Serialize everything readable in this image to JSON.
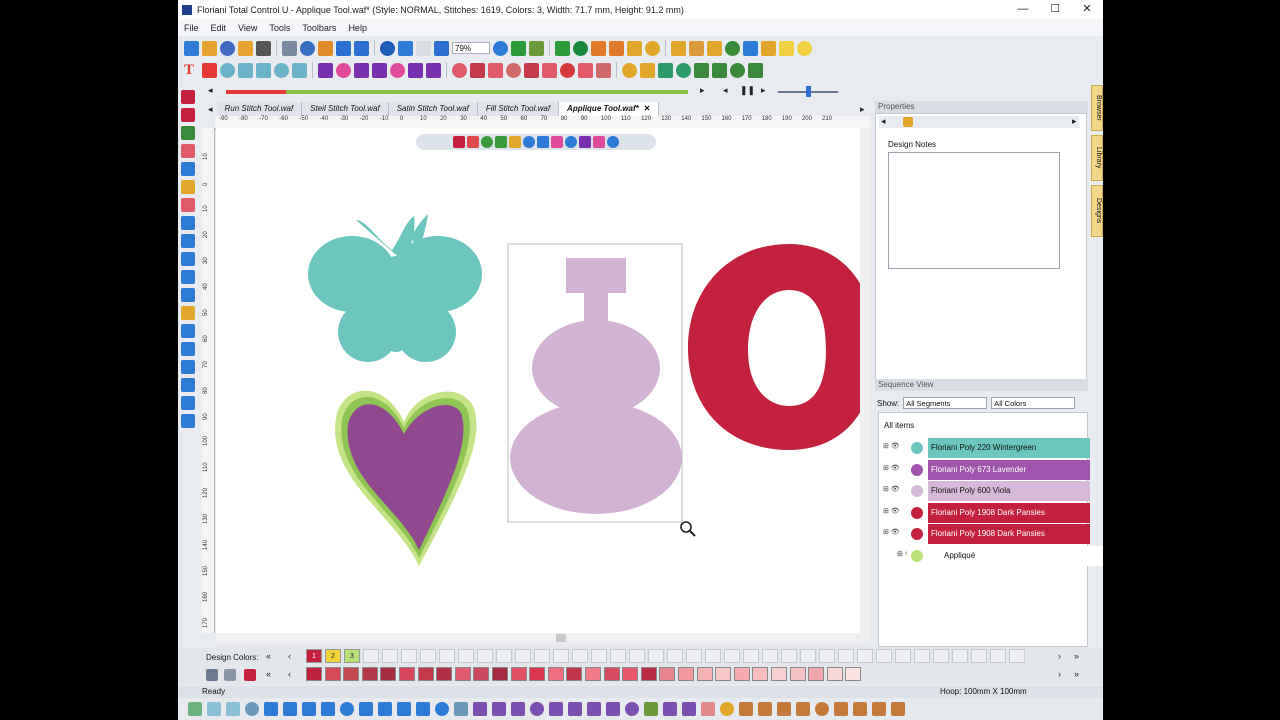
{
  "window": {
    "title": "Floriani Total Control U - Applique Tool.waf* (Style: NORMAL, Stitches: 1619, Colors: 3, Width: 71.7 mm, Height: 91.2 mm)",
    "minimize": "—",
    "maximize": "☐",
    "close": "✕"
  },
  "menu": [
    "File",
    "Edit",
    "View",
    "Tools",
    "Toolbars",
    "Help"
  ],
  "toolbar": {
    "zoom_value": "79%"
  },
  "tabs": [
    {
      "label": "Run Stitch Tool.waf",
      "active": false
    },
    {
      "label": "Steil Stitch Tool.waf",
      "active": false
    },
    {
      "label": "Satin Stitch Tool.waf",
      "active": false
    },
    {
      "label": "Fill Stitch Tool.waf",
      "active": false
    },
    {
      "label": "Applique Tool.waf*",
      "active": true
    }
  ],
  "tab_close": "✕",
  "progress": {
    "fraction": 0.13
  },
  "ruler": {
    "top_labels": [
      "-90",
      "-80",
      "-70",
      "-60",
      "-50",
      "-40",
      "-30",
      "-20",
      "-10",
      "0",
      "10",
      "20",
      "30",
      "40",
      "50",
      "60",
      "70",
      "80",
      "90",
      "100",
      "110",
      "120",
      "130",
      "140",
      "150",
      "160",
      "170",
      "180",
      "190",
      "200",
      "210"
    ],
    "left_labels": [
      "10",
      "0",
      "10",
      "20",
      "30",
      "40",
      "50",
      "60",
      "70",
      "80",
      "90",
      "100",
      "110",
      "120",
      "130",
      "140",
      "150",
      "160",
      "170"
    ]
  },
  "properties": {
    "header": "Properties",
    "design_notes_label": "Design Notes"
  },
  "sequence": {
    "header": "Sequence View",
    "show_label": "Show:",
    "segments_select": "All Segments",
    "colors_select": "All Colors",
    "all_items": "All items",
    "rows": [
      {
        "label": "Floriani Poly 220 Wintergreen",
        "color": "#6cc6bd",
        "text_color": "#111111"
      },
      {
        "label": "Floriani Poly 673 Lavender",
        "color": "#a055ad",
        "text_color": "#ffffff"
      },
      {
        "label": "Floriani Poly 600 Viola",
        "color": "#d6b8d8",
        "text_color": "#111111"
      },
      {
        "label": "Floriani Poly 1908 Dark Pansies",
        "color": "#c4213e",
        "text_color": "#ffffff"
      },
      {
        "label": "Floriani Poly 1908 Dark Pansies",
        "color": "#c4213e",
        "text_color": "#ffffff"
      },
      {
        "label": "Appliqué",
        "color": "#ffffff",
        "text_color": "#111111"
      }
    ]
  },
  "side_tabs": [
    "Browser",
    "Library",
    "Designs"
  ],
  "colors_bar": {
    "label": "Design Colors:",
    "design_colors": [
      {
        "num": "1",
        "color": "#c4213e"
      },
      {
        "num": "2",
        "color": "#f3d33a"
      },
      {
        "num": "3",
        "color": "#b9e07a"
      }
    ],
    "palette": [
      "#c0213f",
      "#d64a55",
      "#c44a50",
      "#b33a48",
      "#a72e40",
      "#d9455b",
      "#c23a4a",
      "#b02f45",
      "#e05b6f",
      "#c94a5f",
      "#a72b42",
      "#e35063",
      "#d9364e",
      "#ee6f7e",
      "#c2364a",
      "#f07a85",
      "#d64a5d",
      "#e9586a",
      "#b92a43",
      "#e7848c",
      "#f29aa0",
      "#f5b3b6",
      "#f7c6c7",
      "#f5aab0",
      "#f7bdbf",
      "#f8d0d1",
      "#f5c0c3",
      "#f0a9ad",
      "#f9d7d8",
      "#fbe3e3"
    ]
  },
  "status": {
    "left": "Ready",
    "right": "Hoop: 100mm X 100mm"
  },
  "icons": {
    "toolbar1": [
      "#2f7bd6",
      "#e8a431",
      "#4169c2",
      "#e8a431",
      "#555555",
      "#7a8aa0",
      "#3a6ec2",
      "#e08a2a",
      "#2d6fd1",
      "#2d6fd1",
      "#1f5bb8",
      "#2d7bd6",
      "#d8dde4",
      "#2d6fd1",
      "#2d7bd6",
      "#2d9a3a",
      "#6a9a3a",
      "#2d9a3a",
      "#1a8a3a",
      "#e07a2a",
      "#e07a2a",
      "#e0a72a",
      "#e0a72a",
      "#e0a72a",
      "#d99a3a",
      "#e0a72a",
      "#3a8a3a",
      "#2d7bd6",
      "#e0a72a",
      "#f0d040",
      "#f0d040"
    ],
    "toolbar2": [
      "#e53935",
      "#6bb3c8",
      "#6bb3c8",
      "#6bb3c8",
      "#6bb3c8",
      "#6bb3c8",
      "#7a2eb0",
      "#e04a9a",
      "#7a2eb0",
      "#7a2eb0",
      "#e04a9a",
      "#7a2eb0",
      "#7a2eb0",
      "#e05a6a",
      "#c43a4a",
      "#e05a6a",
      "#d06a6a",
      "#c43a4a",
      "#e05a6a",
      "#d43a3a",
      "#e05a6a",
      "#d06a6a",
      "#e0a72a",
      "#e0a72a",
      "#2d9a6a",
      "#2d9a6a",
      "#3a8a3a",
      "#3a8a3a",
      "#3a8a3a",
      "#3a8a3a"
    ],
    "leftbar": [
      "#c4213e",
      "#c4213e",
      "#3a8a3a",
      "#e05a6a",
      "#2d7bd6",
      "#e0a72a",
      "#e05a6a",
      "#2d7bd6",
      "#2d7bd6",
      "#2d7bd6",
      "#2d7bd6",
      "#2d7bd6",
      "#e0a72a",
      "#2d7bd6",
      "#2d7bd6",
      "#2d7bd6",
      "#2d7bd6",
      "#2d7bd6",
      "#2d7bd6"
    ],
    "canvas_toolbar": [
      "#c4213e",
      "#e04a4a",
      "#3a9a3a",
      "#3a9a3a",
      "#e0a72a",
      "#2d7bd6",
      "#2d7bd6",
      "#e04a9a",
      "#2d7bd6",
      "#7a2eb0",
      "#e04a9a",
      "#2d7bd6"
    ],
    "bottom": [
      "#6bb37a",
      "#8bbfd8",
      "#8bbfd8",
      "#6b9ab8",
      "#2d7bd6",
      "#2d7bd6",
      "#2d7bd6",
      "#2d7bd6",
      "#2d7bd6",
      "#2d7bd6",
      "#2d7bd6",
      "#2d7bd6",
      "#2d7bd6",
      "#2d7bd6",
      "#6b9ab8",
      "#7a4fb0",
      "#7a4fb0",
      "#7a4fb0",
      "#7a4fb0",
      "#7a4fb0",
      "#7a4fb0",
      "#7a4fb0",
      "#7a4fb0",
      "#7a4fb0",
      "#6b9a3a",
      "#7a4fb0",
      "#7a4fb0",
      "#e08a8a",
      "#e0a72a",
      "#c47a3a",
      "#c47a3a",
      "#c47a3a",
      "#c47a3a",
      "#c47a3a",
      "#c47a3a",
      "#c47a3a",
      "#c47a3a",
      "#c47a3a"
    ]
  }
}
